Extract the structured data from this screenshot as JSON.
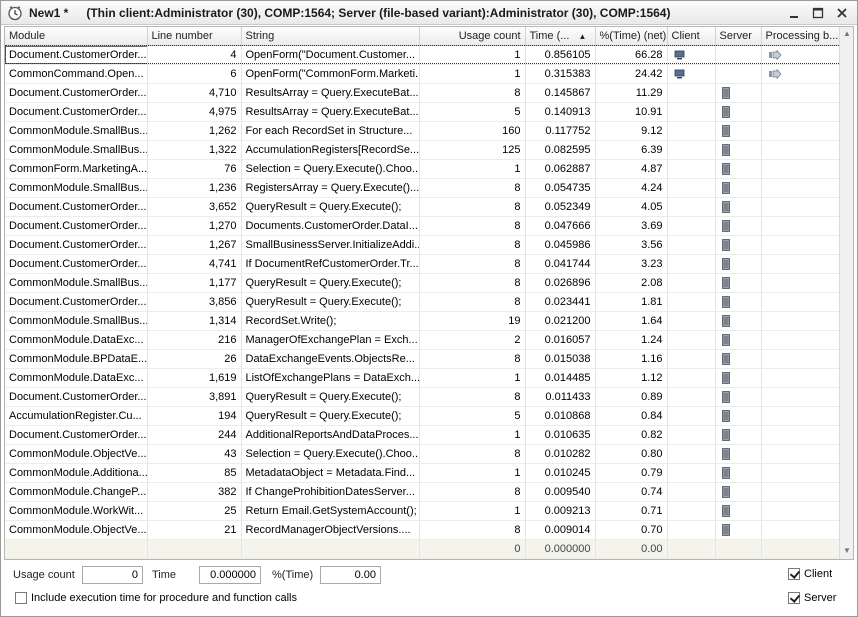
{
  "window": {
    "title": "New1 *",
    "context": "(Thin client:Administrator (30), COMP:1564; Server (file-based variant):Administrator (30), COMP:1564)"
  },
  "columns": {
    "module": "Module",
    "line_number": "Line number",
    "string": "String",
    "usage_count": "Usage count",
    "time": "Time (...",
    "time_net": "%(Time) (net)",
    "client": "Client",
    "server": "Server",
    "processing": "Processing b..."
  },
  "sort_indicator": "▲",
  "rows": [
    {
      "module": "Document.CustomerOrder...",
      "line": "4",
      "string": "OpenForm(\"Document.Customer...",
      "count": "1",
      "time": "0.856105",
      "pct": "66.28",
      "client": true,
      "server": false,
      "processing": true
    },
    {
      "module": "CommonCommand.Open...",
      "line": "6",
      "string": "OpenForm(\"CommonForm.Marketi...",
      "count": "1",
      "time": "0.315383",
      "pct": "24.42",
      "client": true,
      "server": false,
      "processing": true
    },
    {
      "module": "Document.CustomerOrder...",
      "line": "4,710",
      "string": "ResultsArray = Query.ExecuteBat...",
      "count": "8",
      "time": "0.145867",
      "pct": "11.29",
      "client": false,
      "server": true,
      "processing": false
    },
    {
      "module": "Document.CustomerOrder...",
      "line": "4,975",
      "string": "ResultsArray = Query.ExecuteBat...",
      "count": "5",
      "time": "0.140913",
      "pct": "10.91",
      "client": false,
      "server": true,
      "processing": false
    },
    {
      "module": "CommonModule.SmallBus...",
      "line": "1,262",
      "string": "For each RecordSet in Structure...",
      "count": "160",
      "time": "0.117752",
      "pct": "9.12",
      "client": false,
      "server": true,
      "processing": false
    },
    {
      "module": "CommonModule.SmallBus...",
      "line": "1,322",
      "string": "AccumulationRegisters[RecordSe...",
      "count": "125",
      "time": "0.082595",
      "pct": "6.39",
      "client": false,
      "server": true,
      "processing": false
    },
    {
      "module": "CommonForm.MarketingA...",
      "line": "76",
      "string": "Selection = Query.Execute().Choo...",
      "count": "1",
      "time": "0.062887",
      "pct": "4.87",
      "client": false,
      "server": true,
      "processing": false
    },
    {
      "module": "CommonModule.SmallBus...",
      "line": "1,236",
      "string": "RegistersArray = Query.Execute()....",
      "count": "8",
      "time": "0.054735",
      "pct": "4.24",
      "client": false,
      "server": true,
      "processing": false
    },
    {
      "module": "Document.CustomerOrder...",
      "line": "3,652",
      "string": "QueryResult = Query.Execute();",
      "count": "8",
      "time": "0.052349",
      "pct": "4.05",
      "client": false,
      "server": true,
      "processing": false
    },
    {
      "module": "Document.CustomerOrder...",
      "line": "1,270",
      "string": "Documents.CustomerOrder.DataI...",
      "count": "8",
      "time": "0.047666",
      "pct": "3.69",
      "client": false,
      "server": true,
      "processing": false
    },
    {
      "module": "Document.CustomerOrder...",
      "line": "1,267",
      "string": "SmallBusinessServer.InitializeAddi...",
      "count": "8",
      "time": "0.045986",
      "pct": "3.56",
      "client": false,
      "server": true,
      "processing": false
    },
    {
      "module": "Document.CustomerOrder...",
      "line": "4,741",
      "string": "If DocumentRefCustomerOrder.Tr...",
      "count": "8",
      "time": "0.041744",
      "pct": "3.23",
      "client": false,
      "server": true,
      "processing": false
    },
    {
      "module": "CommonModule.SmallBus...",
      "line": "1,177",
      "string": "QueryResult = Query.Execute();",
      "count": "8",
      "time": "0.026896",
      "pct": "2.08",
      "client": false,
      "server": true,
      "processing": false
    },
    {
      "module": "Document.CustomerOrder...",
      "line": "3,856",
      "string": "QueryResult = Query.Execute();",
      "count": "8",
      "time": "0.023441",
      "pct": "1.81",
      "client": false,
      "server": true,
      "processing": false
    },
    {
      "module": "CommonModule.SmallBus...",
      "line": "1,314",
      "string": "RecordSet.Write();",
      "count": "19",
      "time": "0.021200",
      "pct": "1.64",
      "client": false,
      "server": true,
      "processing": false
    },
    {
      "module": "CommonModule.DataExc...",
      "line": "216",
      "string": "ManagerOfExchangePlan = Exch...",
      "count": "2",
      "time": "0.016057",
      "pct": "1.24",
      "client": false,
      "server": true,
      "processing": false
    },
    {
      "module": "CommonModule.BPDataE...",
      "line": "26",
      "string": "DataExchangeEvents.ObjectsRe...",
      "count": "8",
      "time": "0.015038",
      "pct": "1.16",
      "client": false,
      "server": true,
      "processing": false
    },
    {
      "module": "CommonModule.DataExc...",
      "line": "1,619",
      "string": "ListOfExchangePlans = DataExch...",
      "count": "1",
      "time": "0.014485",
      "pct": "1.12",
      "client": false,
      "server": true,
      "processing": false
    },
    {
      "module": "Document.CustomerOrder...",
      "line": "3,891",
      "string": "QueryResult = Query.Execute();",
      "count": "8",
      "time": "0.011433",
      "pct": "0.89",
      "client": false,
      "server": true,
      "processing": false
    },
    {
      "module": "AccumulationRegister.Cu...",
      "line": "194",
      "string": "QueryResult = Query.Execute();",
      "count": "5",
      "time": "0.010868",
      "pct": "0.84",
      "client": false,
      "server": true,
      "processing": false
    },
    {
      "module": "Document.CustomerOrder...",
      "line": "244",
      "string": "AdditionalReportsAndDataProces...",
      "count": "1",
      "time": "0.010635",
      "pct": "0.82",
      "client": false,
      "server": true,
      "processing": false
    },
    {
      "module": "CommonModule.ObjectVe...",
      "line": "43",
      "string": "Selection = Query.Execute().Choo...",
      "count": "8",
      "time": "0.010282",
      "pct": "0.80",
      "client": false,
      "server": true,
      "processing": false
    },
    {
      "module": "CommonModule.Additiona...",
      "line": "85",
      "string": "MetadataObject = Metadata.Find...",
      "count": "1",
      "time": "0.010245",
      "pct": "0.79",
      "client": false,
      "server": true,
      "processing": false
    },
    {
      "module": "CommonModule.ChangeP...",
      "line": "382",
      "string": "If ChangeProhibitionDatesServer...",
      "count": "8",
      "time": "0.009540",
      "pct": "0.74",
      "client": false,
      "server": true,
      "processing": false
    },
    {
      "module": "CommonModule.WorkWit...",
      "line": "25",
      "string": "Return Email.GetSystemAccount();",
      "count": "1",
      "time": "0.009213",
      "pct": "0.71",
      "client": false,
      "server": true,
      "processing": false
    },
    {
      "module": "CommonModule.ObjectVe...",
      "line": "21",
      "string": "RecordManagerObjectVersions....",
      "count": "8",
      "time": "0.009014",
      "pct": "0.70",
      "client": false,
      "server": true,
      "processing": false
    }
  ],
  "footer": {
    "count": "0",
    "time": "0.000000",
    "pct": "0.00"
  },
  "bottom": {
    "usage_count_label": "Usage count",
    "usage_count_value": "0",
    "time_label": "Time",
    "time_value": "0.000000",
    "pct_label": "%(Time)",
    "pct_value": "0.00",
    "include_label": "Include execution time for procedure and function calls",
    "client_label": "Client",
    "server_label": "Server"
  }
}
